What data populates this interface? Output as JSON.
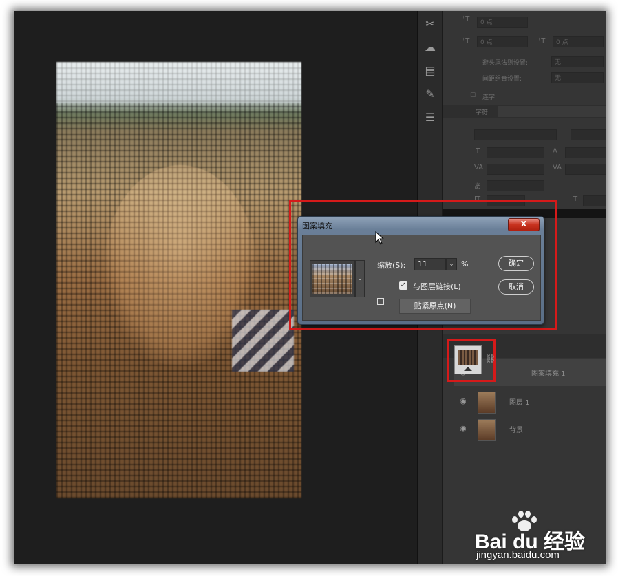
{
  "dialog": {
    "title": "图案填充",
    "close_label": "X",
    "scale_label": "缩放(S):",
    "scale_value": "11",
    "scale_unit": "%",
    "link_checked": true,
    "link_label": "与图层链接(L)",
    "snap_button": "贴紧原点(N)",
    "ok_button": "确定",
    "cancel_button": "取消"
  },
  "layers": [
    {
      "name": "图案填充 1",
      "visible": true,
      "selected": true
    },
    {
      "name": "图层 1",
      "visible": true,
      "selected": false
    },
    {
      "name": "背景",
      "visible": true,
      "selected": false
    }
  ],
  "character_panel": {
    "field_1": "0 点",
    "field_2": "0 点",
    "field_3": "0 点",
    "row_label_1": "避头尾法则设置:",
    "row_value_1": "无",
    "row_label_2": "间距组合设置:",
    "row_value_2": "无",
    "checkbox_label": "连字",
    "tab_label": "字符"
  },
  "watermark": {
    "brand": "Bai du 经验",
    "site": "jingyan.baidu.com"
  },
  "colors": {
    "highlight_red": "#d51a1a",
    "panel_bg": "#353535",
    "canvas_bg": "#1e1e1e"
  }
}
